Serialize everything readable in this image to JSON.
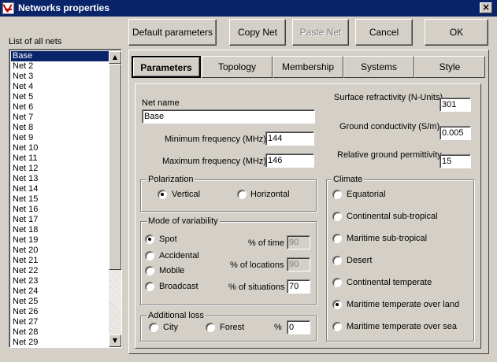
{
  "window": {
    "title": "Networks properties",
    "close_glyph": "×"
  },
  "list": {
    "label": "List of all nets",
    "items": [
      "Base",
      "Net  2",
      "Net  3",
      "Net  4",
      "Net  5",
      "Net  6",
      "Net  7",
      "Net  8",
      "Net  9",
      "Net 10",
      "Net 11",
      "Net 12",
      "Net 13",
      "Net 14",
      "Net 15",
      "Net 16",
      "Net 17",
      "Net 18",
      "Net 19",
      "Net 20",
      "Net 21",
      "Net 22",
      "Net 23",
      "Net 24",
      "Net 25",
      "Net 26",
      "Net 27",
      "Net 28",
      "Net 29"
    ],
    "selected_index": 0,
    "scroll_up_glyph": "▲",
    "scroll_down_glyph": "▼"
  },
  "toolbar": {
    "default_params": "Default parameters",
    "copy_net": "Copy Net",
    "paste_net": "Paste Net",
    "cancel": "Cancel",
    "ok": "OK"
  },
  "tabs": [
    {
      "label": "Parameters",
      "active": true
    },
    {
      "label": "Topology",
      "active": false
    },
    {
      "label": "Membership",
      "active": false
    },
    {
      "label": "Systems",
      "active": false
    },
    {
      "label": "Style",
      "active": false
    }
  ],
  "params": {
    "net_name_label": "Net name",
    "net_name_value": "Base",
    "min_freq_label": "Minimum frequency (MHz)",
    "min_freq_value": "144",
    "max_freq_label": "Maximum frequency (MHz)",
    "max_freq_value": "146",
    "surface_refr_label": "Surface refractivity (N-Units)",
    "surface_refr_value": "301",
    "ground_cond_label": "Ground conductivity (S/m)",
    "ground_cond_value": "0.005",
    "ground_perm_label": "Relative ground permittivity",
    "ground_perm_value": "15"
  },
  "polarization": {
    "title": "Polarization",
    "vertical": "Vertical",
    "horizontal": "Horizontal",
    "selected": "vertical"
  },
  "variability": {
    "title": "Mode of variability",
    "options": [
      "Spot",
      "Accidental",
      "Mobile",
      "Broadcast"
    ],
    "selected_index": 0,
    "time_label": "% of time",
    "time_value": "90",
    "locations_label": "% of locations",
    "locations_value": "90",
    "situations_label": "% of situations",
    "situations_value": "70"
  },
  "additional_loss": {
    "title": "Additional loss",
    "city": "City",
    "forest": "Forest",
    "percent_label": "%",
    "percent_value": "0"
  },
  "climate": {
    "title": "Climate",
    "options": [
      "Equatorial",
      "Continental sub-tropical",
      "Maritime sub-tropical",
      "Desert",
      "Continental temperate",
      "Maritime temperate over land",
      "Maritime temperate over sea"
    ],
    "selected_index": 5
  },
  "colors": {
    "titlebar": "#0a246a",
    "face": "#d4d0c8",
    "selection": "#0a246a"
  }
}
